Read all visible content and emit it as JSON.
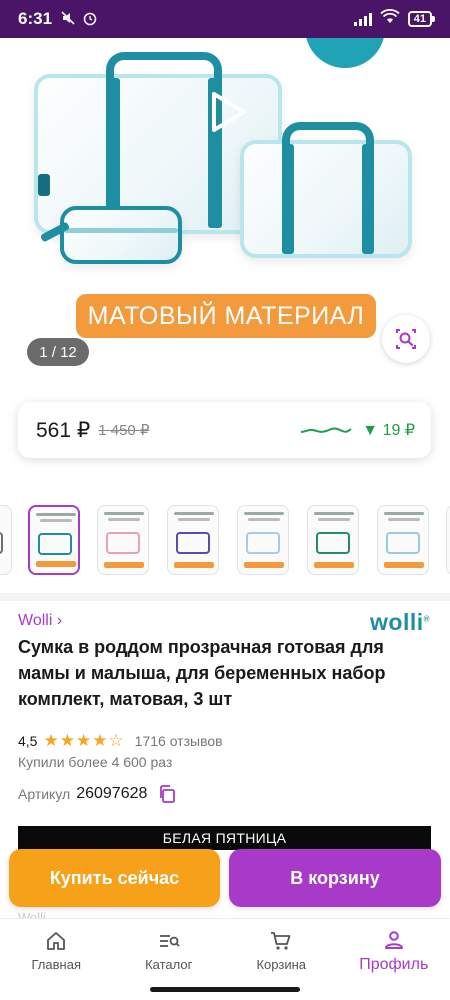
{
  "status": {
    "time": "6:31",
    "battery": "41",
    "icons": [
      "mute-icon",
      "alarm-icon",
      "signal-icon",
      "wifi-icon",
      "battery-icon"
    ]
  },
  "hero": {
    "badge": "МАТОВЫЙ МАТЕРИАЛ",
    "counter": "1 / 12",
    "image": "three-transparent-bags-with-teal-handles"
  },
  "price": {
    "current": "561 ₽",
    "old": "1 450 ₽",
    "drop": "▼ 19 ₽",
    "trend_color": "#1f9f43"
  },
  "thumbnails": [
    {
      "color": "#6e6e6e"
    },
    {
      "color": "#1e8fa3"
    },
    {
      "color": "#e8a0b4"
    },
    {
      "color": "#5a4ea8"
    },
    {
      "color": "#a9cbe8"
    },
    {
      "color": "#1e8f6a"
    },
    {
      "color": "#9cc9e0"
    }
  ],
  "product": {
    "brand_link": "Wolli ›",
    "brand_logo": "wolli",
    "title": "Сумка в роддом прозрачная готовая для мамы и малыша, для беременных набор комплект, матовая, 3 шт",
    "rating": "4,5",
    "stars": "★★★★☆",
    "reviews": "1716 отзывов",
    "bought": "Купили более 4 600 раз",
    "article_label": "Артикул",
    "article_value": "26097628"
  },
  "promo": "БЕЛАЯ ПЯТНИЦА",
  "actions": {
    "buy_now": "Купить сейчас",
    "add_to_cart": "В корзину"
  },
  "peek": "Wolli",
  "nav": {
    "items": [
      {
        "label": "Главная",
        "icon": "home-icon"
      },
      {
        "label": "Каталог",
        "icon": "catalog-icon"
      },
      {
        "label": "Корзина",
        "icon": "cart-icon"
      },
      {
        "label": "Профиль",
        "icon": "profile-icon"
      }
    ],
    "active_color": "#a73ac9"
  }
}
